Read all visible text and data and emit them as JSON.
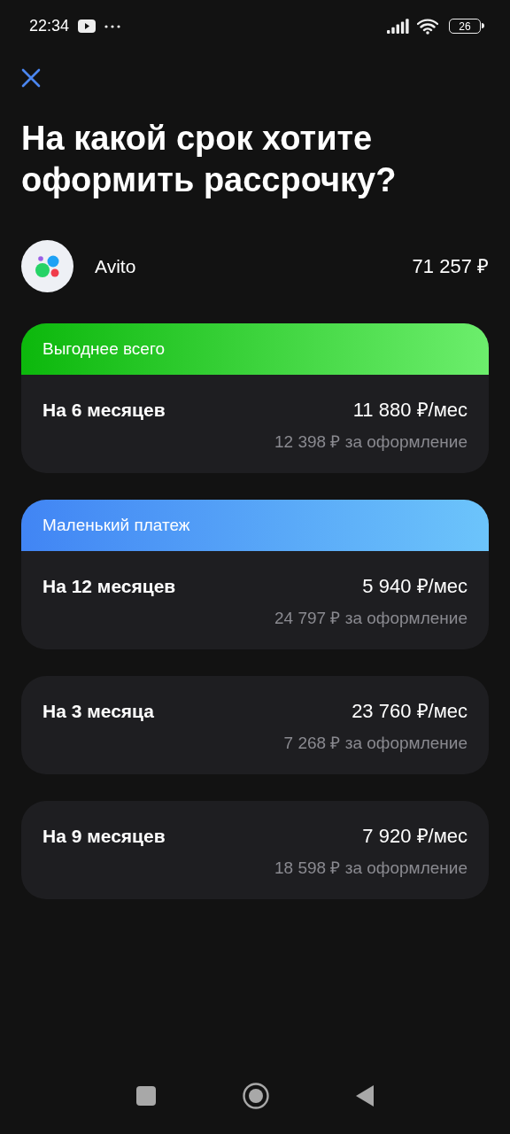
{
  "status_bar": {
    "time": "22:34",
    "battery": "26"
  },
  "title": "На какой срок хотите оформить рассрочку?",
  "merchant": {
    "name": "Avito",
    "amount": "71 257 ₽"
  },
  "plans": [
    {
      "badge": {
        "text": "Выгоднее всего",
        "kind": "green"
      },
      "term": "На 6 месяцев",
      "monthly": "11 880 ₽/мес",
      "fee": "12 398 ₽ за оформление"
    },
    {
      "badge": {
        "text": "Маленький платеж",
        "kind": "blue"
      },
      "term": "На 12 месяцев",
      "monthly": "5 940 ₽/мес",
      "fee": "24 797 ₽ за оформление"
    },
    {
      "term": "На 3 месяца",
      "monthly": "23 760 ₽/мес",
      "fee": "7 268 ₽ за оформление"
    },
    {
      "term": "На 9 месяцев",
      "monthly": "7 920 ₽/мес",
      "fee": "18 598 ₽ за оформление"
    }
  ]
}
